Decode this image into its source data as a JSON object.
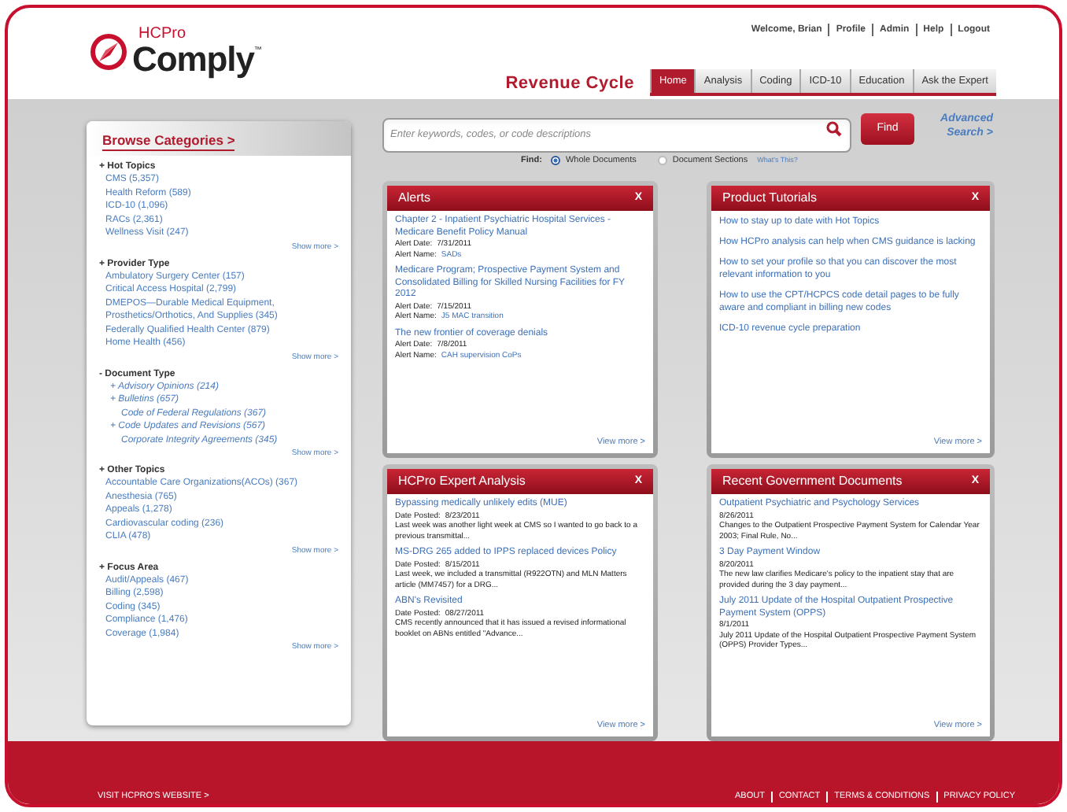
{
  "header": {
    "logo": {
      "small": "HCPro",
      "main": "Comply",
      "mark": "™"
    },
    "user_links": [
      "Welcome, Brian",
      "Profile",
      "Admin",
      "Help",
      "Logout"
    ],
    "section_title": "Revenue Cycle",
    "tabs": [
      {
        "label": "Home",
        "selected": true
      },
      {
        "label": "Analysis",
        "selected": false
      },
      {
        "label": "Coding",
        "selected": false
      },
      {
        "label": "ICD-10",
        "selected": false
      },
      {
        "label": "Education",
        "selected": false
      },
      {
        "label": "Ask the Expert",
        "selected": false
      }
    ]
  },
  "search": {
    "placeholder": "Enter keywords, codes, or code descriptions",
    "button": "Find",
    "advanced": "Advanced Search >",
    "find_label": "Find:",
    "options": [
      {
        "label": "Whole Documents",
        "selected": true
      },
      {
        "label": "Document Sections",
        "selected": false
      }
    ],
    "help_link": "What's This?"
  },
  "sidebar": {
    "title": "Browse Categories >",
    "groups": [
      {
        "marker": "+",
        "label": "Hot Topics",
        "kind": "list",
        "items": [
          {
            "label": "CMS (5,357)"
          },
          {
            "label": "Health Reform (589)"
          },
          {
            "label": "ICD-10 (1,096)"
          },
          {
            "label": "RACs (2,361)"
          },
          {
            "label": "Wellness Visit (247)"
          }
        ],
        "show_more": "Show more >"
      },
      {
        "marker": "+",
        "label": "Provider Type",
        "kind": "list",
        "items": [
          {
            "label": "Ambulatory Surgery Center (157)"
          },
          {
            "label": "Critical Access Hospital (2,799)"
          },
          {
            "label": "DMEPOS—Durable Medical Equipment, Prosthetics/Orthotics, And Supplies (345)"
          },
          {
            "label": "Federally Qualified Health Center (879)"
          },
          {
            "label": "Home Health (456)"
          }
        ],
        "show_more": "Show more >"
      },
      {
        "marker": "-",
        "label": "Document Type",
        "kind": "tree",
        "items": [
          {
            "marker": "+",
            "label": "Advisory Opinions (214)"
          },
          {
            "marker": "+",
            "label": "Bulletins  (657)",
            "children": [
              {
                "label": "Code of Federal Regulations (367)"
              }
            ]
          },
          {
            "marker": "+",
            "label": "Code Updates and Revisions (567)",
            "children": [
              {
                "label": "Corporate Integrity Agreements (345)"
              }
            ]
          }
        ],
        "show_more": "Show more >"
      },
      {
        "marker": "+",
        "label": "Other Topics",
        "kind": "list",
        "items": [
          {
            "label": "Accountable Care Organizations(ACOs) (367)"
          },
          {
            "label": "Anesthesia (765)"
          },
          {
            "label": "Appeals (1,278)"
          },
          {
            "label": "Cardiovascular coding (236)"
          },
          {
            "label": "CLIA (478)"
          }
        ],
        "show_more": "Show more >"
      },
      {
        "marker": "+",
        "label": "Focus Area",
        "kind": "list",
        "items": [
          {
            "label": "Audit/Appeals (467)"
          },
          {
            "label": "Billing (2,598)"
          },
          {
            "label": "Coding (345)"
          },
          {
            "label": "Compliance (1,476)"
          },
          {
            "label": "Coverage (1,984)"
          }
        ],
        "show_more": "Show more >"
      }
    ]
  },
  "panels": [
    {
      "title": "Alerts",
      "close": "X",
      "kind": "entries",
      "entries": [
        {
          "title": "Chapter 2 - Inpatient Psychiatric Hospital Services - Medicare Benefit Policy Manual",
          "meta": [
            {
              "label": "Alert Date:",
              "value": "7/31/2011",
              "kind": "text"
            },
            {
              "label": "Alert Name:",
              "value": "SADs",
              "kind": "link"
            }
          ]
        },
        {
          "title": "Medicare Program; Prospective Payment System and Consolidated Billing for Skilled Nursing Facilities for FY 2012",
          "meta": [
            {
              "label": "Alert Date:",
              "value": "7/15/2011",
              "kind": "text"
            },
            {
              "label": "Alert Name:",
              "value": "J5 MAC transition",
              "kind": "link"
            }
          ]
        },
        {
          "title": "The new frontier of coverage denials",
          "meta": [
            {
              "label": "Alert Date:",
              "value": "7/8/2011",
              "kind": "text"
            },
            {
              "label": "Alert Name:",
              "value": "CAH supervision CoPs",
              "kind": "link"
            }
          ]
        }
      ],
      "view_more": "View more >"
    },
    {
      "title": "Product Tutorials",
      "close": "X",
      "kind": "links",
      "entries": [
        {
          "title": "How to stay up to date with Hot Topics"
        },
        {
          "title": "How HCPro analysis can help when CMS guidance is lacking"
        },
        {
          "title": "How to set your profile so that you can discover the most relevant information to you"
        },
        {
          "title": "How to use the CPT/HCPCS code detail pages to be fully aware and compliant in billing new codes"
        },
        {
          "title": "ICD-10 revenue cycle preparation"
        }
      ],
      "view_more": "View more >"
    },
    {
      "title": "HCPro Expert Analysis",
      "close": "X",
      "kind": "entries",
      "entries": [
        {
          "title": "Bypassing medically unlikely edits (MUE)",
          "meta": [
            {
              "label": "Date Posted:",
              "value": "8/23/2011",
              "kind": "text"
            }
          ],
          "summary": "Last week was another light week at CMS so I wanted to go back to a previous transmittal..."
        },
        {
          "title": "MS-DRG 265 added to IPPS replaced devices Policy",
          "meta": [
            {
              "label": "Date Posted:",
              "value": "8/15/2011",
              "kind": "text"
            }
          ],
          "summary": "Last week, we included a transmittal (R922OTN) and MLN Matters article (MM7457) for a DRG..."
        },
        {
          "title": "ABN's Revisited",
          "meta": [
            {
              "label": "Date Posted:",
              "value": "08/27/2011",
              "kind": "text"
            }
          ],
          "summary": "CMS recently announced that it has issued a revised informational booklet on ABNs entitled \"Advance..."
        }
      ],
      "view_more": "View more >"
    },
    {
      "title": "Recent Government Documents",
      "close": "X",
      "kind": "entries",
      "entries": [
        {
          "title": "Outpatient Psychiatric and Psychology Services",
          "date": "8/26/2011",
          "summary": "Changes to the Outpatient Prospective Payment System for Calendar Year 2003; Final Rule, No..."
        },
        {
          "title": "3 Day Payment Window",
          "date": "8/20/2011",
          "summary": "The new law clarifies Medicare's policy to the inpatient stay that are provided during the 3 day payment..."
        },
        {
          "title": "July 2011 Update of the Hospital Outpatient Prospective Payment System (OPPS)",
          "date": "8/1/2011",
          "summary": "July 2011 Update of the Hospital Outpatient Prospective Payment System (OPPS) Provider Types..."
        }
      ],
      "view_more": "View more >"
    }
  ],
  "footer": {
    "site_link": "VISIT HCPRO'S WEBSITE >",
    "links": [
      "ABOUT",
      "CONTACT",
      "TERMS & CONDITIONS",
      "PRIVACY POLICY"
    ]
  }
}
